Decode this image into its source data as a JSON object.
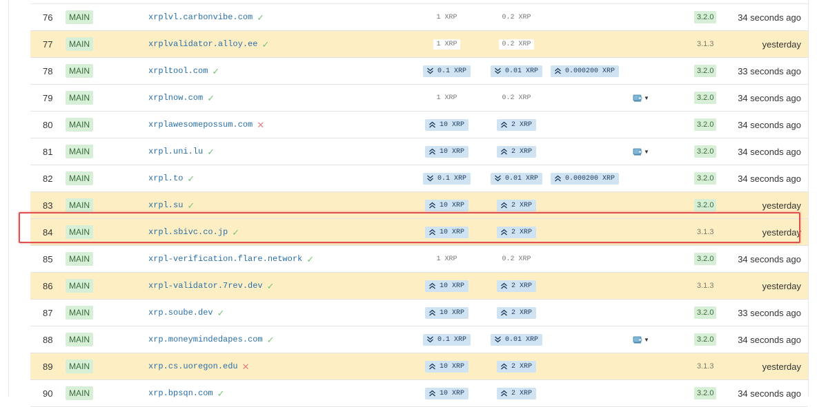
{
  "rows": [
    {
      "num": "76",
      "network": "MAIN",
      "domain": "xrplvl.carbonvibe.com",
      "verified": true,
      "fees": [
        {
          "text": "1 XRP",
          "kind": "plain"
        },
        {
          "text": "0.2 XRP",
          "kind": "plain"
        },
        null
      ],
      "account_icon": false,
      "version": "3.2.0",
      "latest": true,
      "seen": "34 seconds ago",
      "warn": false
    },
    {
      "num": "77",
      "network": "MAIN",
      "domain": "xrplvalidator.alloy.ee",
      "verified": true,
      "fees": [
        {
          "text": "1 XRP",
          "kind": "plain"
        },
        {
          "text": "0.2 XRP",
          "kind": "plain"
        },
        null
      ],
      "account_icon": false,
      "version": "3.1.3",
      "latest": false,
      "seen": "yesterday",
      "warn": true
    },
    {
      "num": "78",
      "network": "MAIN",
      "domain": "xrpltool.com",
      "verified": true,
      "fees": [
        {
          "text": "0.1 XRP",
          "kind": "down"
        },
        {
          "text": "0.01 XRP",
          "kind": "down"
        },
        {
          "text": "0.000200 XRP",
          "kind": "up"
        }
      ],
      "account_icon": false,
      "version": "3.2.0",
      "latest": true,
      "seen": "33 seconds ago",
      "warn": false
    },
    {
      "num": "79",
      "network": "MAIN",
      "domain": "xrplnow.com",
      "verified": true,
      "fees": [
        {
          "text": "1 XRP",
          "kind": "plain"
        },
        {
          "text": "0.2 XRP",
          "kind": "plain"
        },
        null
      ],
      "account_icon": true,
      "version": "3.2.0",
      "latest": true,
      "seen": "34 seconds ago",
      "warn": false
    },
    {
      "num": "80",
      "network": "MAIN",
      "domain": "xrplawesomepossum.com",
      "verified": false,
      "fees": [
        {
          "text": "10 XRP",
          "kind": "up"
        },
        {
          "text": "2 XRP",
          "kind": "up"
        },
        null
      ],
      "account_icon": false,
      "version": "3.2.0",
      "latest": true,
      "seen": "34 seconds ago",
      "warn": false
    },
    {
      "num": "81",
      "network": "MAIN",
      "domain": "xrpl.uni.lu",
      "verified": true,
      "fees": [
        {
          "text": "10 XRP",
          "kind": "up"
        },
        {
          "text": "2 XRP",
          "kind": "up"
        },
        null
      ],
      "account_icon": true,
      "version": "3.2.0",
      "latest": true,
      "seen": "34 seconds ago",
      "warn": false
    },
    {
      "num": "82",
      "network": "MAIN",
      "domain": "xrpl.to",
      "verified": true,
      "fees": [
        {
          "text": "0.1 XRP",
          "kind": "down"
        },
        {
          "text": "0.01 XRP",
          "kind": "down"
        },
        {
          "text": "0.000200 XRP",
          "kind": "up"
        }
      ],
      "account_icon": false,
      "version": "3.2.0",
      "latest": true,
      "seen": "34 seconds ago",
      "warn": false
    },
    {
      "num": "83",
      "network": "MAIN",
      "domain": "xrpl.su",
      "verified": true,
      "fees": [
        {
          "text": "10 XRP",
          "kind": "up"
        },
        {
          "text": "2 XRP",
          "kind": "up"
        },
        null
      ],
      "account_icon": false,
      "version": "3.2.0",
      "latest": true,
      "seen": "yesterday",
      "warn": true
    },
    {
      "num": "84",
      "network": "MAIN",
      "domain": "xrpl.sbivc.co.jp",
      "verified": true,
      "fees": [
        {
          "text": "10 XRP",
          "kind": "up"
        },
        {
          "text": "2 XRP",
          "kind": "up"
        },
        null
      ],
      "account_icon": false,
      "version": "3.1.3",
      "latest": false,
      "seen": "yesterday",
      "warn": true
    },
    {
      "num": "85",
      "network": "MAIN",
      "domain": "xrpl-verification.flare.network",
      "verified": true,
      "fees": [
        {
          "text": "1 XRP",
          "kind": "plain"
        },
        {
          "text": "0.2 XRP",
          "kind": "plain"
        },
        null
      ],
      "account_icon": false,
      "version": "3.2.0",
      "latest": true,
      "seen": "34 seconds ago",
      "warn": false
    },
    {
      "num": "86",
      "network": "MAIN",
      "domain": "xrpl-validator.7rev.dev",
      "verified": true,
      "fees": [
        {
          "text": "10 XRP",
          "kind": "up"
        },
        {
          "text": "2 XRP",
          "kind": "up"
        },
        null
      ],
      "account_icon": false,
      "version": "3.1.3",
      "latest": false,
      "seen": "yesterday",
      "warn": true
    },
    {
      "num": "87",
      "network": "MAIN",
      "domain": "xrp.soube.dev",
      "verified": true,
      "fees": [
        {
          "text": "10 XRP",
          "kind": "up"
        },
        {
          "text": "2 XRP",
          "kind": "up"
        },
        null
      ],
      "account_icon": false,
      "version": "3.2.0",
      "latest": true,
      "seen": "33 seconds ago",
      "warn": false
    },
    {
      "num": "88",
      "network": "MAIN",
      "domain": "xrp.moneymindedapes.com",
      "verified": true,
      "fees": [
        {
          "text": "0.1 XRP",
          "kind": "down"
        },
        {
          "text": "0.01 XRP",
          "kind": "down"
        },
        null
      ],
      "account_icon": true,
      "version": "3.2.0",
      "latest": true,
      "seen": "34 seconds ago",
      "warn": false
    },
    {
      "num": "89",
      "network": "MAIN",
      "domain": "xrp.cs.uoregon.edu",
      "verified": false,
      "fees": [
        {
          "text": "10 XRP",
          "kind": "up"
        },
        {
          "text": "2 XRP",
          "kind": "up"
        },
        null
      ],
      "account_icon": false,
      "version": "3.1.3",
      "latest": false,
      "seen": "yesterday",
      "warn": true
    },
    {
      "num": "90",
      "network": "MAIN",
      "domain": "xrp.bpsqn.com",
      "verified": true,
      "fees": [
        {
          "text": "10 XRP",
          "kind": "up"
        },
        {
          "text": "2 XRP",
          "kind": "up"
        },
        null
      ],
      "account_icon": false,
      "version": "3.2.0",
      "latest": true,
      "seen": "34 seconds ago",
      "warn": false
    }
  ],
  "icons": {
    "verified": "check-icon",
    "unverified": "cross-icon",
    "fee_up": "chevron-double-up-icon",
    "fee_down": "chevron-double-down-icon",
    "account": "wallet-icon"
  },
  "colors": {
    "warn_row": "#fdefc3",
    "badge_green": "#d6efd6",
    "fee_badge": "#cfe3f3",
    "link": "#2a6fa8",
    "highlight": "#e05050"
  },
  "highlighted_row": "84"
}
